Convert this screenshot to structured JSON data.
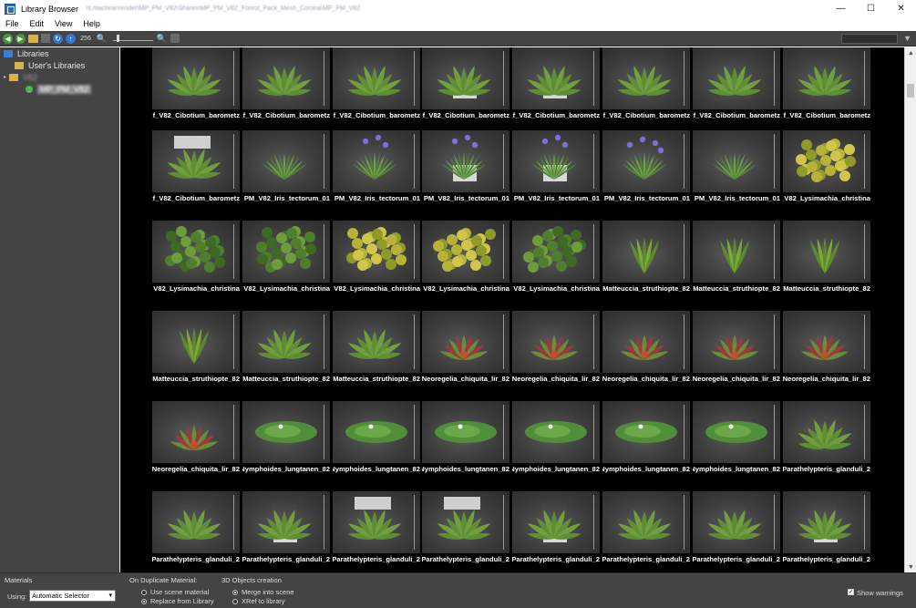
{
  "window": {
    "title": "Library Browser",
    "path": "\\\\Lmachine\\render\\MP_PM_V82\\Shares\\MP_PM_V82_Forest_Pack_Mesh_Corona\\MP_PM_V82",
    "minimize": "—",
    "maximize": "☐",
    "close": "✕"
  },
  "menu": [
    "File",
    "Edit",
    "View",
    "Help"
  ],
  "toolbar": {
    "size_label": "256",
    "zoom_out": "−",
    "zoom_in": "+",
    "filter_icon": "▼",
    "search_value": ""
  },
  "sidebar": {
    "items": [
      {
        "label": "Libraries",
        "icon": "library-icon"
      },
      {
        "label": "User's Libraries",
        "icon": "folder-icon"
      },
      {
        "label": "V82",
        "icon": "folder-icon"
      },
      {
        "label": "MP_PM_V82",
        "icon": "library-green-icon"
      }
    ]
  },
  "grid": {
    "rows": [
      [
        "f_V82_Cibotium_barometz_",
        "f_V82_Cibotium_barometz_",
        "f_V82_Cibotium_barometz_",
        "f_V82_Cibotium_barometz_",
        "f_V82_Cibotium_barometz_",
        "f_V82_Cibotium_barometz_",
        "f_V82_Cibotium_barometz_",
        "f_V82_Cibotium_barometz_"
      ],
      [
        "f_V82_Cibotium_barometz_",
        "PM_V82_Iris_tectorum_01",
        "PM_V82_Iris_tectorum_01",
        "PM_V82_Iris_tectorum_01",
        "PM_V82_Iris_tectorum_01",
        "PM_V82_Iris_tectorum_01",
        "PM_V82_Iris_tectorum_01",
        "PM_V82_Lysimachia_christina"
      ],
      [
        "V82_Lysimachia_christina",
        "V82_Lysimachia_christina",
        "V82_Lysimachia_christina",
        "V82_Lysimachia_christina",
        "V82_Lysimachia_christina",
        "82_Matteuccia_struthiopte",
        "82_Matteuccia_struthiopte",
        "82_Matteuccia_struthiopte"
      ],
      [
        "82_Matteuccia_struthiopte",
        "82_Matteuccia_struthiopte",
        "82_Matteuccia_struthiopte",
        "82_Neoregelia_chiquita_lir",
        "82_Neoregelia_chiquita_lir",
        "82_Neoregelia_chiquita_lir",
        "82_Neoregelia_chiquita_lir",
        "82_Neoregelia_chiquita_lir"
      ],
      [
        "82_Neoregelia_chiquita_lir",
        "82_Nymphoides_lungtanen",
        "82_Nymphoides_lungtanen",
        "82_Nymphoides_lungtanen",
        "82_Nymphoides_lungtanen",
        "82_Nymphoides_lungtanen",
        "82_Nymphoides_lungtanen",
        "2_Parathelypteris_glanduli"
      ],
      [
        "2_Parathelypteris_glanduli",
        "2_Parathelypteris_glanduli",
        "2_Parathelypteris_glanduli",
        "2_Parathelypteris_glanduli",
        "2_Parathelypteris_glanduli",
        "2_Parathelypteris_glanduli",
        "2_Parathelypteris_glanduli",
        "2_Parathelypteris_glanduli"
      ]
    ],
    "row_kinds": [
      [
        "fern",
        "fern",
        "fern",
        "fern-pot",
        "fern-pot",
        "fern",
        "fern",
        "fern"
      ],
      [
        "fern-hang",
        "grass",
        "iris",
        "iris-pot",
        "iris-pot",
        "iris-wide",
        "grass",
        "shrub-yellow"
      ],
      [
        "shrub-green",
        "shrub-green",
        "shrub-yellow",
        "shrub-yellow",
        "shrub-green",
        "sprout",
        "sprout",
        "sprout"
      ],
      [
        "sprout",
        "fern",
        "fern",
        "bromeliad",
        "bromeliad",
        "bromeliad",
        "bromeliad",
        "bromeliad"
      ],
      [
        "bromeliad",
        "lily",
        "lily",
        "lily",
        "lily",
        "lily",
        "lily",
        "fern"
      ],
      [
        "fern",
        "fern-pot",
        "fern-hang",
        "fern-hang",
        "fern-pot",
        "fern",
        "fern",
        "fern-pot"
      ]
    ]
  },
  "bottom": {
    "materials_label": "Materials",
    "using_label": "Using:",
    "using_value": "Automatic Selector",
    "duplicate_label": "On Duplicate Material:",
    "use_scene": "Use scene material",
    "replace_lib": "Replace from Library",
    "objects_label": "3D Objects creation",
    "merge_scene": "Merge into scene",
    "xref_lib": "XRef to library",
    "show_warnings": "Show warnings"
  }
}
